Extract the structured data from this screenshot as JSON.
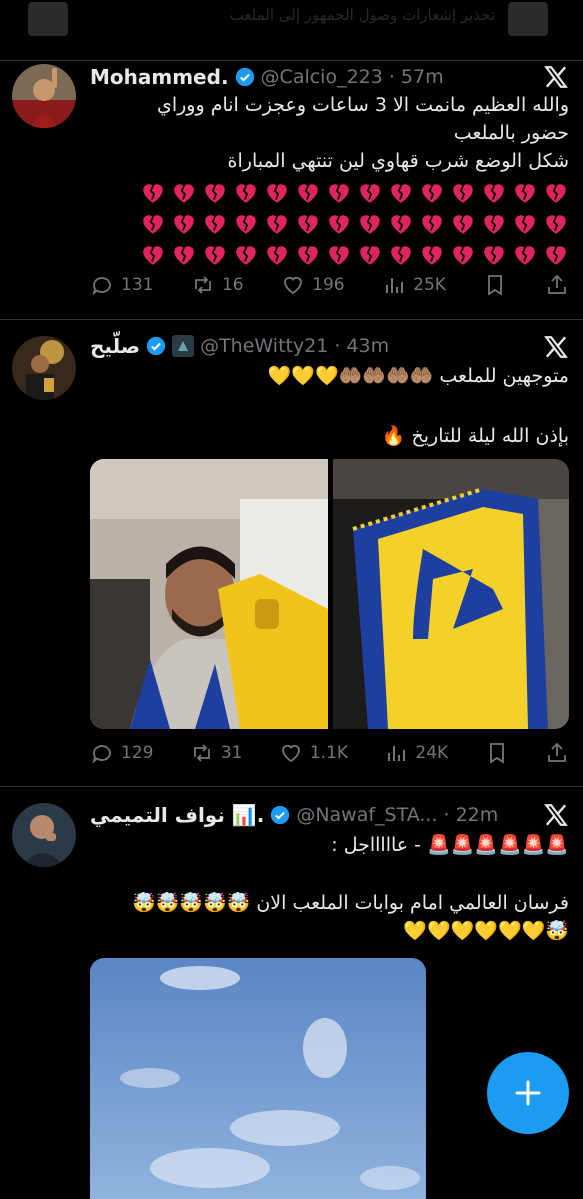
{
  "top_banner": {
    "text": "تحذير إشعارات وصول الجمهور إلى الملعب"
  },
  "tweets": [
    {
      "name": "Mohammed.",
      "handle": "@Calcio_223",
      "time": "57m",
      "lines": [
        "والله العظيم مانمت الا 3 ساعات وعجزت انام ووراي",
        "حضور بالملعب",
        "شكل الوضع شرب قهاوي لين تنتهي المباراة"
      ],
      "emoji": "broken-heart-icon",
      "emoji_rows": 3,
      "emoji_per_row": 14,
      "replies": "131",
      "reposts": "16",
      "likes": "196",
      "views": "25K"
    },
    {
      "name": "صلّيح",
      "handle": "@TheWitty21",
      "time": "43m",
      "line1": "متوجهين للملعب 🤲🏽🤲🏽🤲🏽🤲🏽💛💛💛",
      "line2": "بإذن الله ليلة للتاريخ 🔥",
      "replies": "129",
      "reposts": "31",
      "likes": "1.1K",
      "views": "24K"
    },
    {
      "name": "نواف التميمي 📊.",
      "handle": "@Nawaf_STA...",
      "time": "22m",
      "line1": "🚨🚨🚨🚨🚨🚨 - عاااااجل :",
      "line2": "فرسان العالمي امام بوابات الملعب الان 🤯🤯🤯🤯🤯",
      "line3": "🤯💛💛💛💛💛💛"
    }
  ],
  "fab": {
    "icon": "plus-icon"
  },
  "colors": {
    "accent": "#1d9bf0",
    "background": "#000000",
    "muted": "#71767b"
  }
}
